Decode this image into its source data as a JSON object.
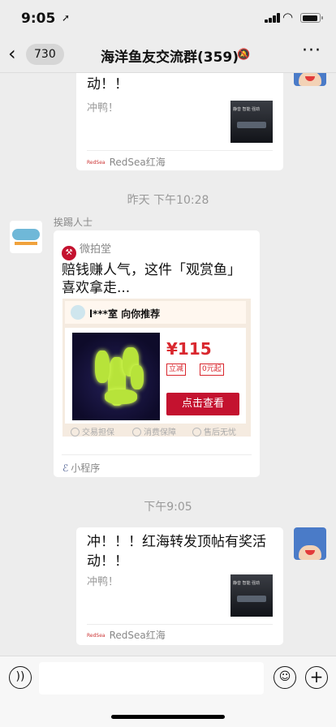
{
  "status_bar": {
    "time": "9:05",
    "battery_level": 0.9
  },
  "nav": {
    "back_count": "730",
    "title": "海洋鱼友交流群(359)"
  },
  "messages": {
    "top_card": {
      "title": "冲！！！红海转发顶帖有奖活动！！",
      "desc": "冲鸭！",
      "source": "RedSea红海"
    },
    "timestamp_1": "昨天 下午10:28",
    "sender": "挨踢人士",
    "mini_program": {
      "brand": "微拍堂",
      "title": "赔钱赚人气，这件「观赏鱼」喜欢拿走...",
      "shop": "l***室 向你推荐",
      "price": "¥115",
      "tag_1": "立减",
      "tag_2": "0元起",
      "buy_label": "点击查看",
      "guarantees": [
        "交易担保",
        "消费保障",
        "售后无忧"
      ],
      "type_label": "小程序"
    },
    "timestamp_2": "下午9:05",
    "bottom_card": {
      "title": "冲！！！红海转发顶帖有奖活动！！",
      "desc": "冲鸭！",
      "source": "RedSea红海"
    }
  },
  "colors": {
    "accent_red": "#c4122f",
    "price_red": "#d9272e",
    "background": "#ededed"
  }
}
